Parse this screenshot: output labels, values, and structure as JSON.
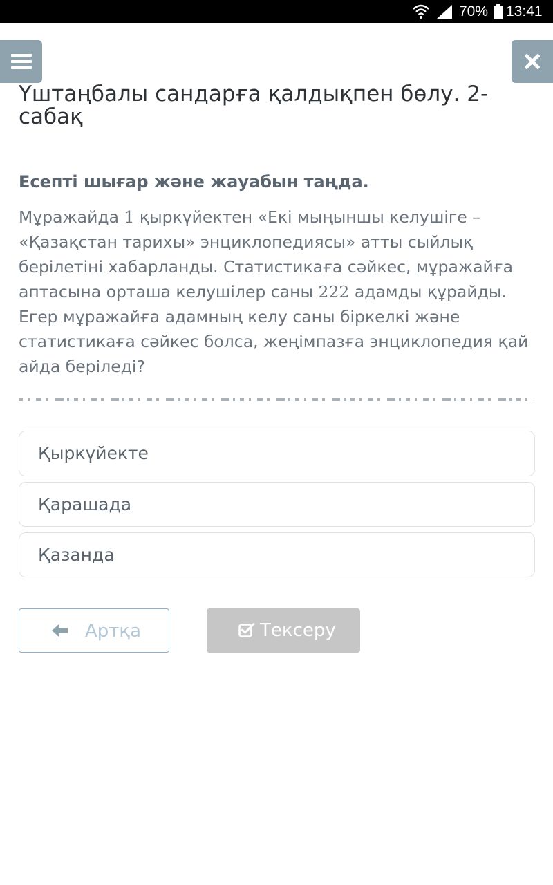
{
  "status_bar": {
    "battery_percent": "70%",
    "time": "13:41"
  },
  "header": {
    "menu_icon": "hamburger-menu-icon",
    "close_icon": "close-icon"
  },
  "lesson": {
    "title": "Үштаңбалы сандарға қалдықпен бөлу. 2-сабақ",
    "instruction": "Есепті шығар және жауабын таңда.",
    "question_parts": [
      "Мұражайда ",
      "1",
      " қыркүйектен «Екі мыңыншы келушіге – «Қазақстан тарихы» энциклопедиясы» атты сыйлық берілетіні хабарланды. Статистикаға сәйкес, мұражайға аптасына орташа келушілер саны ",
      "222",
      " адамды құрайды. Егер мұражайға адамның келу саны біркелкі және статистикаға сәйкес болса, жеңімпазға энциклопедия қай айда беріледі?"
    ]
  },
  "options": [
    {
      "label": "Қыркүйекте"
    },
    {
      "label": "Қарашада"
    },
    {
      "label": "Қазанда"
    }
  ],
  "actions": {
    "back_label": "Артқа",
    "back_icon": "arrow-left-icon",
    "check_label": "Тексеру",
    "check_icon": "check-square-icon"
  },
  "colors": {
    "header_button": "#8fa3ae",
    "check_button_disabled": "#c6c6c6",
    "back_button_border": "#8fb0c6"
  }
}
